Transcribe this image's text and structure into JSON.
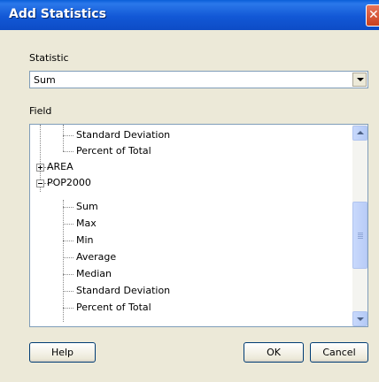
{
  "window": {
    "title": "Add Statistics"
  },
  "statistic": {
    "label": "Statistic",
    "value": "Sum"
  },
  "field": {
    "label": "Field",
    "tree": [
      {
        "text": "Standard Deviation",
        "level": 1
      },
      {
        "text": "Percent of Total",
        "level": 1
      },
      {
        "text": "AREA",
        "level": 0,
        "expander": "+"
      },
      {
        "text": "POP2000",
        "level": 0,
        "expander": "-"
      },
      {
        "text": "Sum",
        "level": 1
      },
      {
        "text": "Max",
        "level": 1
      },
      {
        "text": "Min",
        "level": 1
      },
      {
        "text": "Average",
        "level": 1
      },
      {
        "text": "Median",
        "level": 1
      },
      {
        "text": "Standard Deviation",
        "level": 1
      },
      {
        "text": "Percent of Total",
        "level": 1
      }
    ]
  },
  "buttons": {
    "help": "Help",
    "ok": "OK",
    "cancel": "Cancel"
  }
}
